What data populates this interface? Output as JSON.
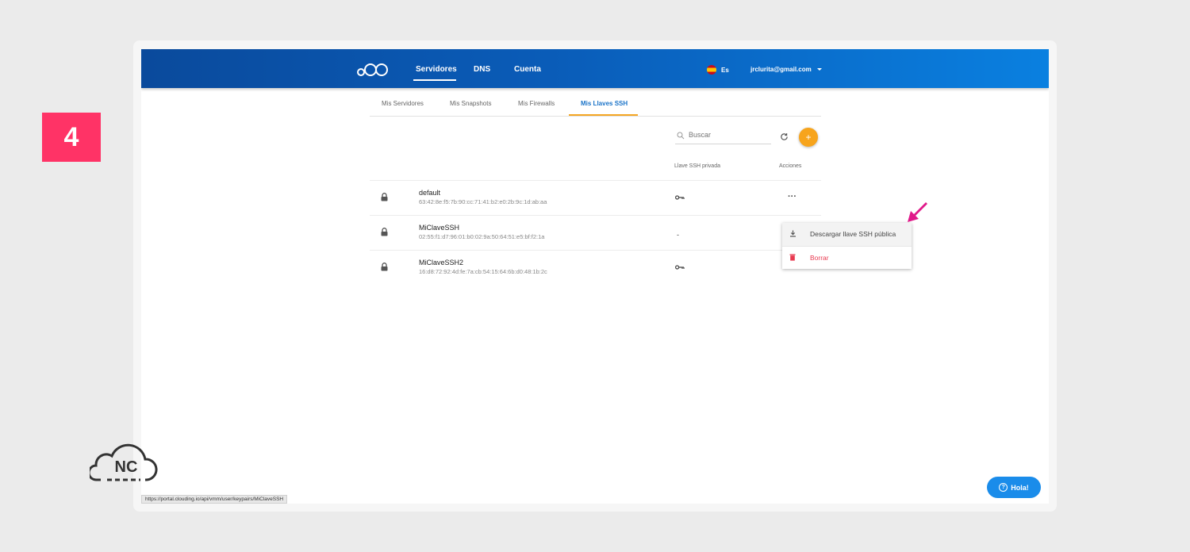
{
  "step": {
    "number": "4"
  },
  "nav": {
    "items": [
      "Servidores",
      "DNS",
      "Cuenta"
    ],
    "language": "Es",
    "user_email": "jrclurita@gmail.com"
  },
  "tabs": [
    "Mis Servidores",
    "Mis Snapshots",
    "Mis Firewalls",
    "Mis Llaves SSH"
  ],
  "active_tab": "Mis Llaves SSH",
  "search": {
    "placeholder": "Buscar"
  },
  "add_button": {
    "label": "+"
  },
  "table": {
    "columns": [
      "Llave SSH privada",
      "Acciones"
    ],
    "rows": [
      {
        "name": "default",
        "fingerprint": "63:42:8e:f5:7b:90:cc:71:41:b2:e0:2b:9c:1d:ab:aa",
        "private_key": "key-icon"
      },
      {
        "name": "MiClaveSSH",
        "fingerprint": "02:55:f1:d7:96:01:b0:02:9a:50:64:51:e5:bf:f2:1a",
        "private_key": "-"
      },
      {
        "name": "MiClaveSSH2",
        "fingerprint": "16:d8:72:92:4d:fe:7a:cb:54:15:64:6b:d0:48:1b:2c",
        "private_key": "key-icon"
      }
    ],
    "actions_label": "···"
  },
  "context_menu": {
    "items": [
      {
        "label": "Descargar llave SSH pública",
        "icon": "download-icon"
      },
      {
        "label": "Borrar",
        "icon": "trash-icon"
      }
    ]
  },
  "chat": {
    "label": "Hola!",
    "icon": "?"
  },
  "status_bar": {
    "url": "https://portal.clouding.io/api/vmm/user/keypairs/MiClaveSSH"
  },
  "watermark": {
    "text": "NC"
  },
  "colors": {
    "accent": "#f7a41c",
    "brand_blue": "#0a5cb8",
    "danger": "#e8394f",
    "badge": "#ff3366",
    "pointer": "#e0198a"
  }
}
